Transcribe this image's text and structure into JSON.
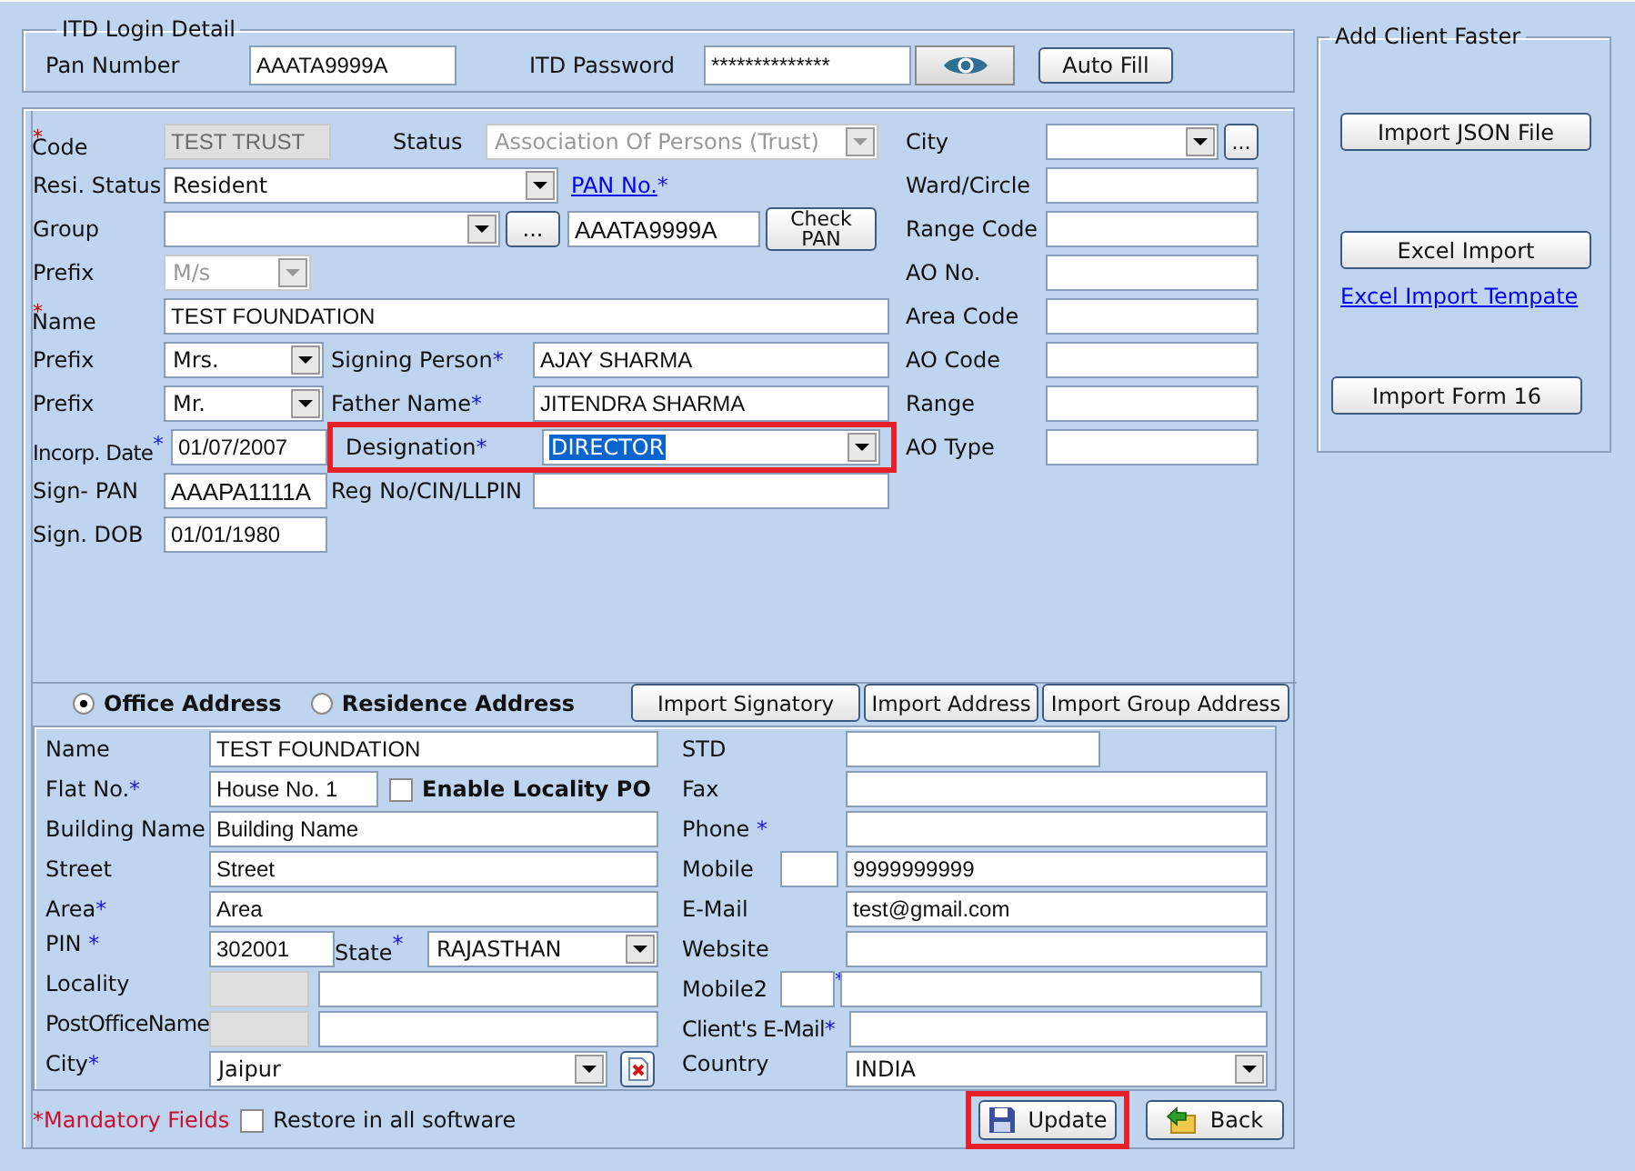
{
  "login": {
    "title": "ITD Login Detail",
    "pan_label": "Pan Number",
    "pan_value": "AAATA9999A",
    "password_label": "ITD Password",
    "password_value": "**************",
    "autofill": "Auto Fill"
  },
  "client": {
    "code": {
      "label": "Code",
      "mark": "*",
      "value": "TEST TRUST",
      "disabled": true
    },
    "status": {
      "label": "Status",
      "value": "Association Of Persons (Trust)",
      "disabled": true
    },
    "resi_status": {
      "label": "Resi. Status",
      "value": "Resident"
    },
    "pan_no": {
      "label": "PAN No.",
      "mark": "*",
      "value": "AAATA9999A"
    },
    "check_pan": "Check PAN",
    "group": {
      "label": "Group"
    },
    "group_more": "...",
    "prefix": {
      "label": "Prefix",
      "value": "M/s",
      "disabled": true
    },
    "name": {
      "label": "Name",
      "mark": "*",
      "value": "TEST FOUNDATION"
    },
    "signatory_prefix": {
      "label": "Prefix",
      "value": "Mrs."
    },
    "signing_person": {
      "label": "Signing Person",
      "mark": "*",
      "value": "AJAY SHARMA"
    },
    "father_prefix": {
      "label": "Prefix",
      "value": "Mr."
    },
    "father_name": {
      "label": "Father Name",
      "mark": "*",
      "value": "JITENDRA SHARMA"
    },
    "incorp_date": {
      "label": "Incorp. Date",
      "mark": "*",
      "value": "01/07/2007"
    },
    "designation": {
      "label": "Designation",
      "mark": "*",
      "value": "DIRECTOR",
      "selected": true,
      "highlighted": true
    },
    "sign_pan": {
      "label": "Sign- PAN",
      "value": "AAAPA1111A"
    },
    "reg_no": {
      "label": "Reg No/CIN/LLPIN"
    },
    "sign_dob": {
      "label": "Sign. DOB",
      "value": "01/01/1980"
    },
    "city": {
      "label": "City"
    },
    "city_more": "...",
    "ao_fields": [
      {
        "label": "Ward/Circle"
      },
      {
        "label": "Range Code"
      },
      {
        "label": "AO No."
      },
      {
        "label": "Area Code"
      },
      {
        "label": "AO Code"
      },
      {
        "label": "Range"
      },
      {
        "label": "AO Type"
      }
    ]
  },
  "address": {
    "types": [
      {
        "label": "Office Address",
        "selected": true
      },
      {
        "label": "Residence Address",
        "selected": false
      }
    ],
    "import_buttons": [
      "Import Signatory",
      "Import Address",
      "Import Group Address"
    ],
    "name": {
      "label": "Name",
      "value": "TEST FOUNDATION"
    },
    "flat_no": {
      "label": "Flat No.",
      "mark": "*",
      "value": "House No. 1"
    },
    "enable_locality": {
      "label": "Enable Locality PO",
      "checked": false
    },
    "building": {
      "label": "Building Name",
      "value": "Building Name"
    },
    "street": {
      "label": "Street",
      "value": "Street"
    },
    "area": {
      "label": "Area",
      "mark": "*",
      "value": "Area"
    },
    "pin": {
      "label": "PIN",
      "mark": "*",
      "value": "302001"
    },
    "state": {
      "label": "State",
      "mark": "*",
      "value": "RAJASTHAN"
    },
    "locality": {
      "label": "Locality",
      "disabled": true
    },
    "post_office": {
      "label": "PostOfficeName",
      "disabled": true
    },
    "city": {
      "label": "City",
      "mark": "*",
      "value": "Jaipur"
    },
    "std": {
      "label": "STD"
    },
    "fax": {
      "label": "Fax"
    },
    "phone": {
      "label": "Phone",
      "mark": "*"
    },
    "mobile": {
      "label": "Mobile",
      "value": "9999999999"
    },
    "email": {
      "label": "E-Mail",
      "value": "test@gmail.com"
    },
    "website": {
      "label": "Website"
    },
    "mobile2": {
      "label": "Mobile2",
      "mark": "*"
    },
    "client_email": {
      "label": "Client's E-Mail",
      "mark": "*"
    },
    "country": {
      "label": "Country",
      "value": "INDIA"
    }
  },
  "footer": {
    "mandatory": "*Mandatory Fields",
    "restore": {
      "label": "Restore in all software",
      "checked": false
    },
    "buttons": [
      {
        "label": "Update",
        "kind": "save",
        "highlighted": true
      },
      {
        "label": "Back",
        "kind": "back",
        "highlighted": false
      }
    ]
  },
  "side": {
    "title": "Add Client Faster",
    "import_json": "Import JSON File",
    "excel_import": "Excel Import",
    "template_link": "Excel Import Tempate",
    "import_form16": "Import Form 16"
  }
}
